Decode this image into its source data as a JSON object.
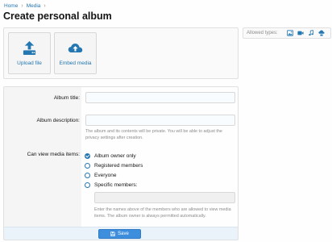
{
  "breadcrumb": {
    "items": [
      "Home",
      "Media"
    ]
  },
  "page": {
    "title": "Create personal album"
  },
  "upload": {
    "upload_file_label": "Upload file",
    "embed_media_label": "Embed media"
  },
  "allowed_types": {
    "label": "Allowed types:",
    "icons": [
      "image-icon",
      "video-icon",
      "audio-icon",
      "embed-icon"
    ]
  },
  "form": {
    "album_title_label": "Album title:",
    "album_title_value": "",
    "album_description_label": "Album description:",
    "album_description_value": "",
    "description_hint": "The album and its contents will be private. You will be able to adjust the privacy settings after creation.",
    "view_label": "Can view media items:",
    "view_options": [
      {
        "label": "Album owner only",
        "selected": true
      },
      {
        "label": "Registered members",
        "selected": false
      },
      {
        "label": "Everyone",
        "selected": false
      },
      {
        "label": "Specific members:",
        "selected": false
      }
    ],
    "members_value": "",
    "members_hint": "Enter the names above of the members who are allowed to view media items. The album owner is always permitted automatically."
  },
  "footer": {
    "save_label": "Save"
  },
  "colors": {
    "accent": "#2577b1",
    "button": "#3e8ede",
    "footer_bg": "#eaf2fa"
  }
}
